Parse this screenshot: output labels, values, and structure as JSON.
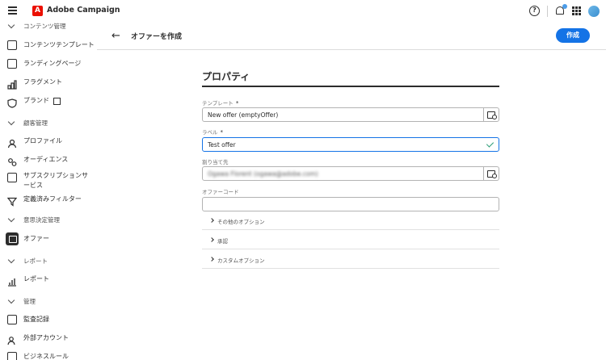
{
  "app": {
    "name": "Adobe Campaign"
  },
  "header": {
    "title": "オファーを作成",
    "create_label": "作成"
  },
  "sidebar": {
    "items": [
      {
        "label": "コンテンツ管理"
      },
      {
        "label": "コンテンツテンプレート"
      },
      {
        "label": "ランディングページ"
      },
      {
        "label": "フラグメント"
      },
      {
        "label": "ブランド"
      },
      {
        "label": "顧客管理"
      },
      {
        "label": "プロファイル"
      },
      {
        "label": "オーディエンス"
      },
      {
        "label": "サブスクリプションサ"
      },
      {
        "label": "ービス"
      },
      {
        "label": "定義済みフィルター"
      },
      {
        "label": "意思決定管理"
      },
      {
        "label": "オファー"
      },
      {
        "label": "レポート"
      },
      {
        "label": "レポート"
      },
      {
        "label": "管理"
      },
      {
        "label": "監査記録"
      },
      {
        "label": "外部アカウント"
      },
      {
        "label": "ビジネスルール"
      }
    ]
  },
  "form": {
    "section_title": "プロパティ",
    "template": {
      "label": "テンプレート",
      "required_mark": "*",
      "value": "New offer (emptyOffer)"
    },
    "label_field": {
      "label": "ラベル",
      "required_mark": "*",
      "value": "Test offer"
    },
    "assigned_to": {
      "label": "割り当て先",
      "value": "Ogawa Florent (ogawa@adobe.com)"
    },
    "offer_code": {
      "label": "オファーコード",
      "value": ""
    },
    "accordions": [
      {
        "label": "その他のオプション"
      },
      {
        "label": "承認"
      },
      {
        "label": "カスタムオプション"
      }
    ]
  },
  "colors": {
    "accent": "#1473e6",
    "valid": "#2d9d78",
    "brand": "#eb1000"
  }
}
